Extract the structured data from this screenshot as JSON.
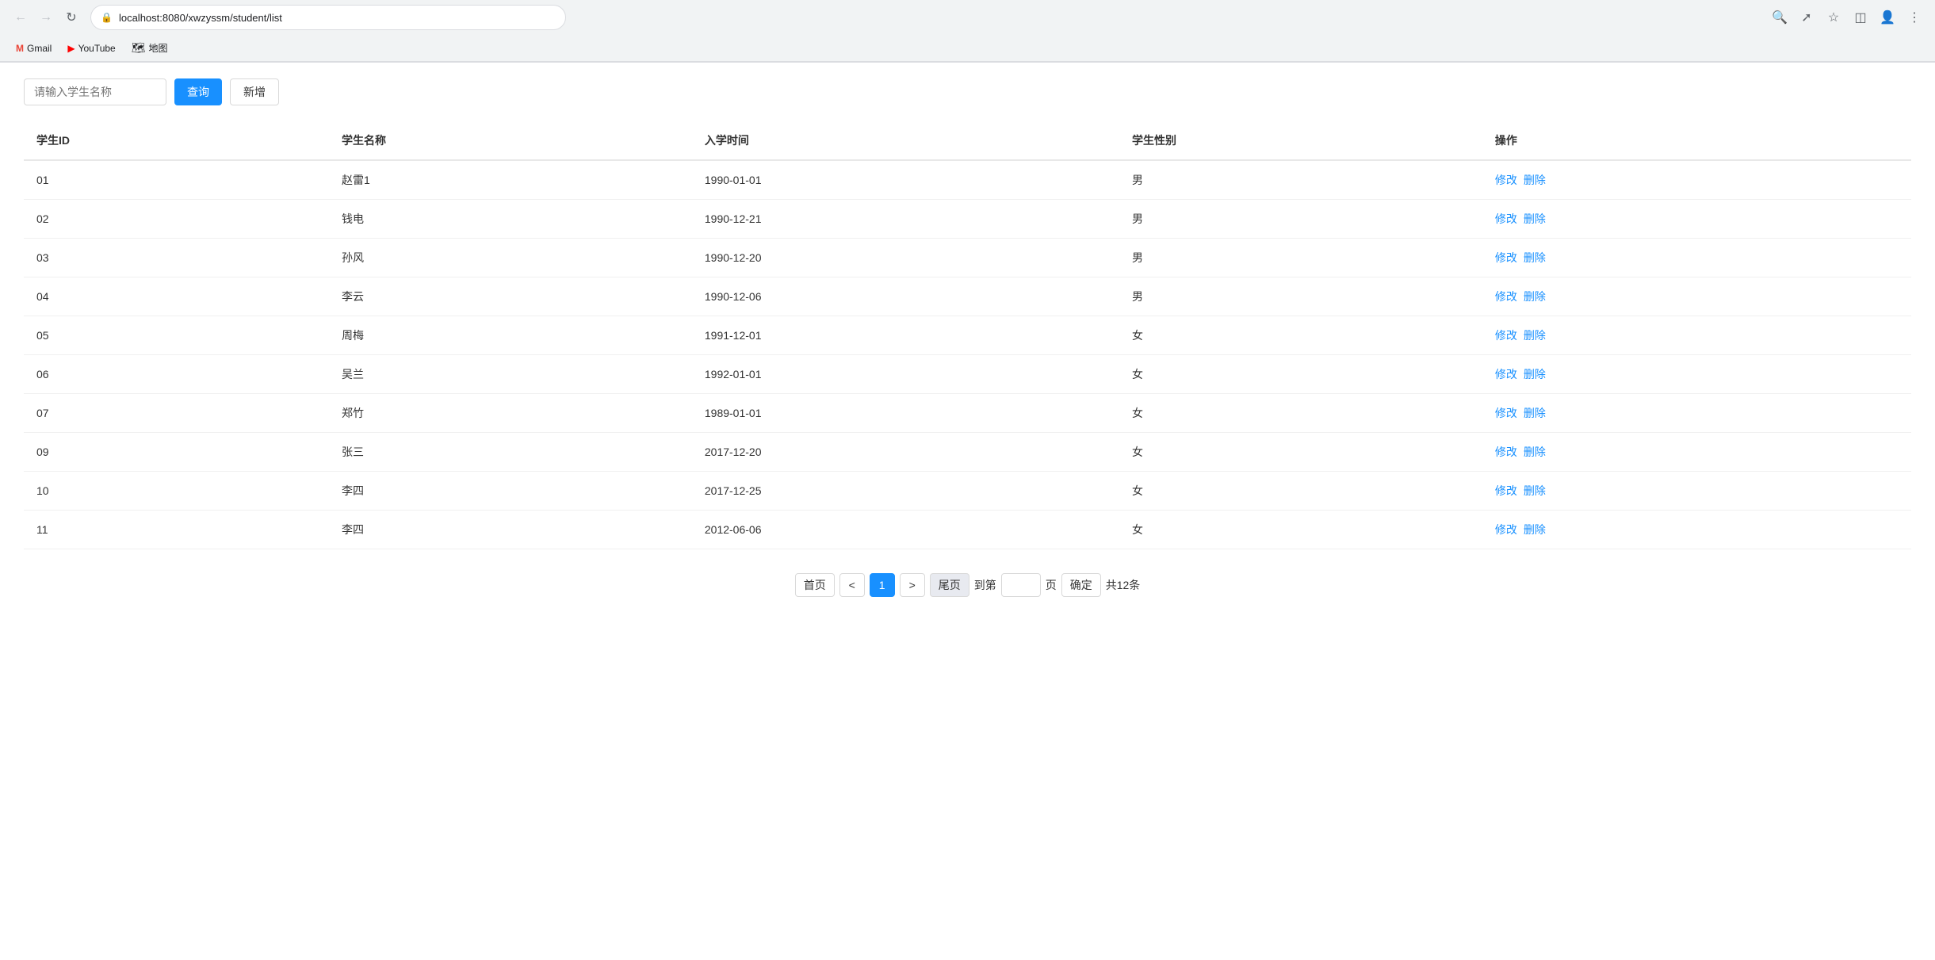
{
  "browser": {
    "url": "localhost:8080/xwzyssm/student/list",
    "back_disabled": true,
    "forward_disabled": true,
    "bookmarks": [
      {
        "label": "Gmail",
        "icon": "gmail"
      },
      {
        "label": "YouTube",
        "icon": "youtube"
      },
      {
        "label": "地图",
        "icon": "map"
      }
    ]
  },
  "filter": {
    "search_placeholder": "请输入学生名称",
    "query_label": "查询",
    "add_label": "新增"
  },
  "table": {
    "columns": [
      "学生ID",
      "学生名称",
      "入学时间",
      "学生性别",
      "操作"
    ],
    "rows": [
      {
        "id": "01",
        "name": "赵雷1",
        "date": "1990-01-01",
        "gender": "男"
      },
      {
        "id": "02",
        "name": "钱电",
        "date": "1990-12-21",
        "gender": "男"
      },
      {
        "id": "03",
        "name": "孙风",
        "date": "1990-12-20",
        "gender": "男"
      },
      {
        "id": "04",
        "name": "李云",
        "date": "1990-12-06",
        "gender": "男"
      },
      {
        "id": "05",
        "name": "周梅",
        "date": "1991-12-01",
        "gender": "女"
      },
      {
        "id": "06",
        "name": "吴兰",
        "date": "1992-01-01",
        "gender": "女"
      },
      {
        "id": "07",
        "name": "郑竹",
        "date": "1989-01-01",
        "gender": "女"
      },
      {
        "id": "09",
        "name": "张三",
        "date": "2017-12-20",
        "gender": "女"
      },
      {
        "id": "10",
        "name": "李四",
        "date": "2017-12-25",
        "gender": "女"
      },
      {
        "id": "11",
        "name": "李四",
        "date": "2012-06-06",
        "gender": "女"
      }
    ],
    "action_edit": "修改",
    "action_delete": "删除"
  },
  "pagination": {
    "first_label": "首页",
    "prev_label": "<",
    "next_label": ">",
    "last_label": "尾页",
    "goto_prefix": "到第",
    "goto_suffix": "页",
    "confirm_label": "确定",
    "total_label": "共12条",
    "current_page": "1"
  }
}
